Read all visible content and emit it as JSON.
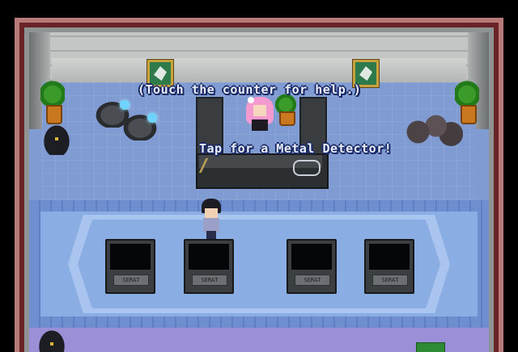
{
  "hud": {
    "help_text": "(Touch the counter for help.)",
    "detector_prompt": "Tap for a Metal Detector!"
  },
  "boards": [
    {
      "label": "SERAT"
    },
    {
      "label": "SERAT"
    },
    {
      "label": "SERAT"
    },
    {
      "label": "SERAT"
    }
  ],
  "colors": {
    "floor": "#7f9bd1",
    "carpet": "#8aaee4",
    "wall_trim": "#b77a78",
    "text_outline": "#1b2a66"
  }
}
